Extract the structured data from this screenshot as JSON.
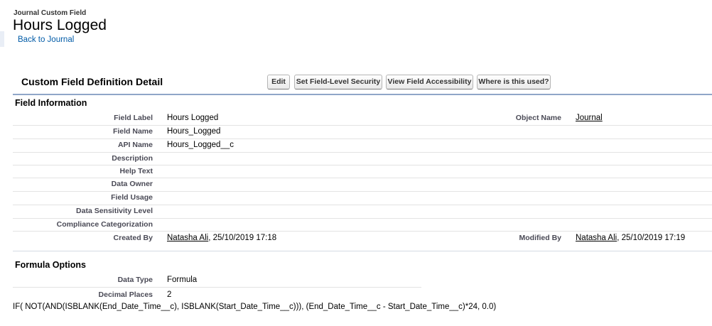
{
  "header": {
    "object_type": "Journal Custom Field",
    "title": "Hours Logged",
    "back_link": "Back to Journal"
  },
  "detail": {
    "section_title": "Custom Field Definition Detail",
    "buttons": {
      "edit": "Edit",
      "set_security": "Set Field-Level Security",
      "view_accessibility": "View Field Accessibility",
      "where_used": "Where is this used?"
    }
  },
  "field_info": {
    "heading": "Field Information",
    "labels": {
      "field_label": "Field Label",
      "field_name": "Field Name",
      "api_name": "API Name",
      "description": "Description",
      "help_text": "Help Text",
      "data_owner": "Data Owner",
      "field_usage": "Field Usage",
      "data_sensitivity": "Data Sensitivity Level",
      "compliance": "Compliance Categorization",
      "created_by": "Created By",
      "object_name": "Object Name",
      "modified_by": "Modified By"
    },
    "values": {
      "field_label": "Hours Logged",
      "field_name": "Hours_Logged",
      "api_name": "Hours_Logged__c",
      "object_name": "Journal",
      "created_by_user": "Natasha Ali",
      "created_by_date": ", 25/10/2019 17:18",
      "modified_by_user": "Natasha Ali",
      "modified_by_date": ", 25/10/2019 17:19"
    }
  },
  "formula_options": {
    "heading": "Formula Options",
    "labels": {
      "data_type": "Data Type",
      "decimal_places": "Decimal Places"
    },
    "values": {
      "data_type": "Formula",
      "decimal_places": "2",
      "formula": "IF( NOT(AND(ISBLANK(End_Date_Time__c), ISBLANK(Start_Date_Time__c))), (End_Date_Time__c - Start_Date_Time__c)*24, 0.0)"
    }
  }
}
